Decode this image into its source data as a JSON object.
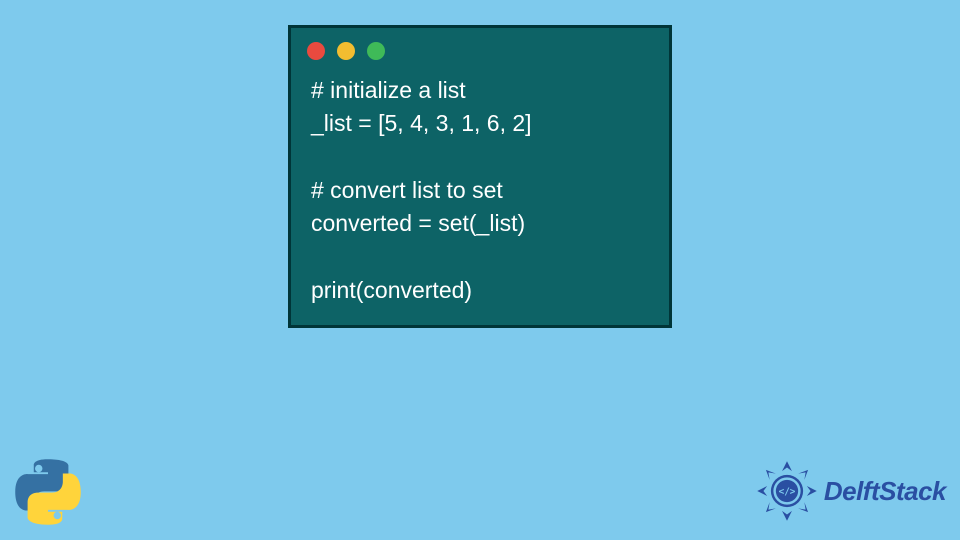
{
  "code": {
    "lines": [
      "# initialize a list",
      "_list = [5, 4, 3, 1, 6, 2]",
      "",
      "# convert list to set",
      "converted = set(_list)",
      "",
      "print(converted)"
    ]
  },
  "window": {
    "traffic_lights": [
      "red",
      "yellow",
      "green"
    ]
  },
  "brand": {
    "name": "DelftStack",
    "color": "#2a4fa2"
  },
  "decor": {
    "python_logo": "python-logo-icon"
  }
}
